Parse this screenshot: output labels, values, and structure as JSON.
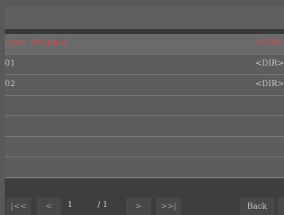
{
  "list": {
    "rows": [
      {
        "name": "Open Original",
        "type": "<DIR>",
        "selected": true
      },
      {
        "name": "01",
        "type": "<DIR>"
      },
      {
        "name": "02",
        "type": "<DIR>"
      },
      {
        "name": "",
        "type": ""
      },
      {
        "name": "",
        "type": ""
      },
      {
        "name": "",
        "type": ""
      },
      {
        "name": "",
        "type": ""
      }
    ]
  },
  "footer": {
    "first_label": "|<<",
    "prev_label": "<",
    "current_page": "1",
    "total_pages": "/ 1",
    "next_label": ">",
    "last_label": ">>|",
    "back_label": "Back"
  },
  "colors": {
    "selected_text": "#d84a4a",
    "normal_text": "#c6c6c6",
    "background": "#595959"
  }
}
